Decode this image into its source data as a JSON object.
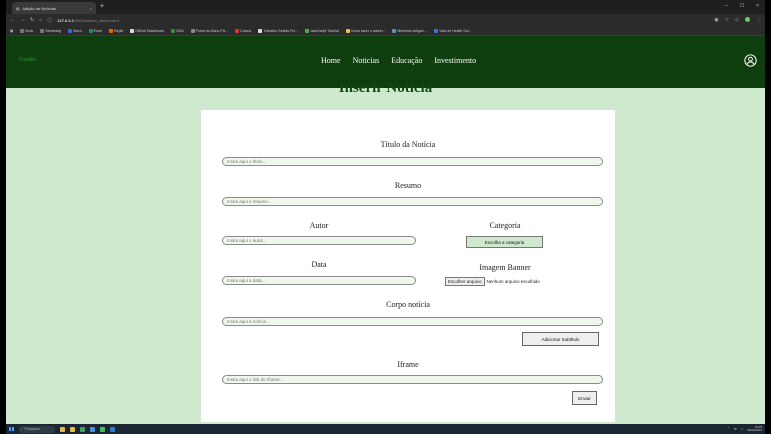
{
  "browser": {
    "tab_title": "Adição de Notícias",
    "tab_close": "×",
    "new_tab": "+",
    "url_host": "127.0.0.1",
    "url_path": ":5500/adicao_dados.html",
    "window_controls": [
      "–",
      "☐",
      "×"
    ],
    "bookmarks": [
      "Book",
      "Streaming",
      "Word",
      "Excel",
      "Replit",
      "GitHub Dashboard",
      "GDA",
      "Portal do Aluno PU...",
      "Cursos",
      "Trabalho Gestão Fin...",
      "JavaScript Tutorial",
      "Como fazer o rastrei...",
      "Melhores Artigos ...",
      "Vida de Health Gui..."
    ]
  },
  "site": {
    "logo": "Gestão",
    "nav": [
      "Home",
      "Noticias",
      "Educação",
      "Investimento"
    ]
  },
  "page": {
    "title": "Inserir Notícia"
  },
  "form": {
    "titulo_label": "Título da Notícia",
    "titulo_placeholder": "Insira aqui o título...",
    "resumo_label": "Resumo",
    "resumo_placeholder": "Insira aqui o resumo...",
    "autor_label": "Autor",
    "autor_placeholder": "Insira aqui o autor...",
    "categoria_label": "Categoria",
    "categoria_button": "Escolha a categoria",
    "data_label": "Data",
    "data_placeholder": "Insira aqui a data...",
    "banner_label": "Imagem Banner",
    "file_button": "Escolher arquivo",
    "file_status": "Nenhum arquivo escolhido",
    "corpo_label": "Corpo notícia",
    "corpo_placeholder": "Insira aqui a notícia...",
    "subtitulo_button": "Adicionar Subtítulo",
    "iframe_label": "Iframe",
    "iframe_placeholder": "Insira aqui o link do Iframe...",
    "enviar_button": "Enviar"
  },
  "taskbar": {
    "search_placeholder": "Pesquisar",
    "time": "16:05",
    "date": "18/06/2023"
  }
}
